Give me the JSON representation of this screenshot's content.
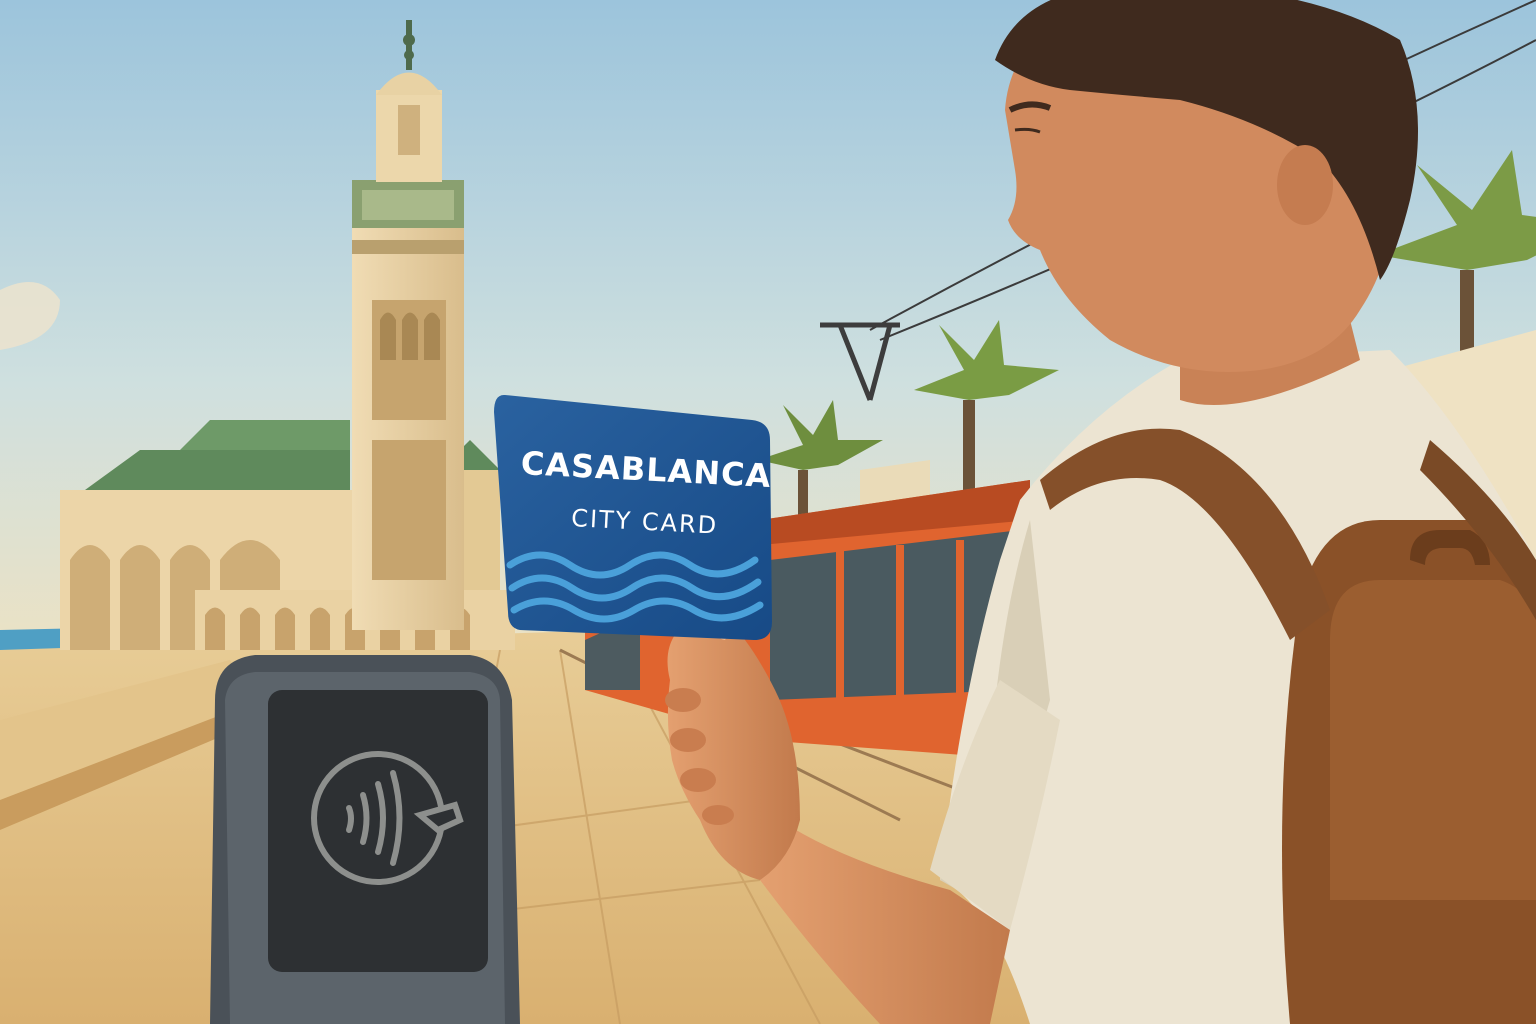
{
  "card": {
    "line1": "CASABLANCA",
    "line2": "CITY CARD",
    "color": "#1f5590"
  },
  "reader": {
    "icon": "contactless-tap-icon"
  },
  "palette": {
    "sky_top": "#a8cbe0",
    "sky_bottom": "#efe3c6",
    "stone": "#e6cfa3",
    "roof_green": "#5f8a5c",
    "tram_orange": "#e0642f",
    "shirt": "#ece4d2",
    "backpack": "#8a5128"
  }
}
